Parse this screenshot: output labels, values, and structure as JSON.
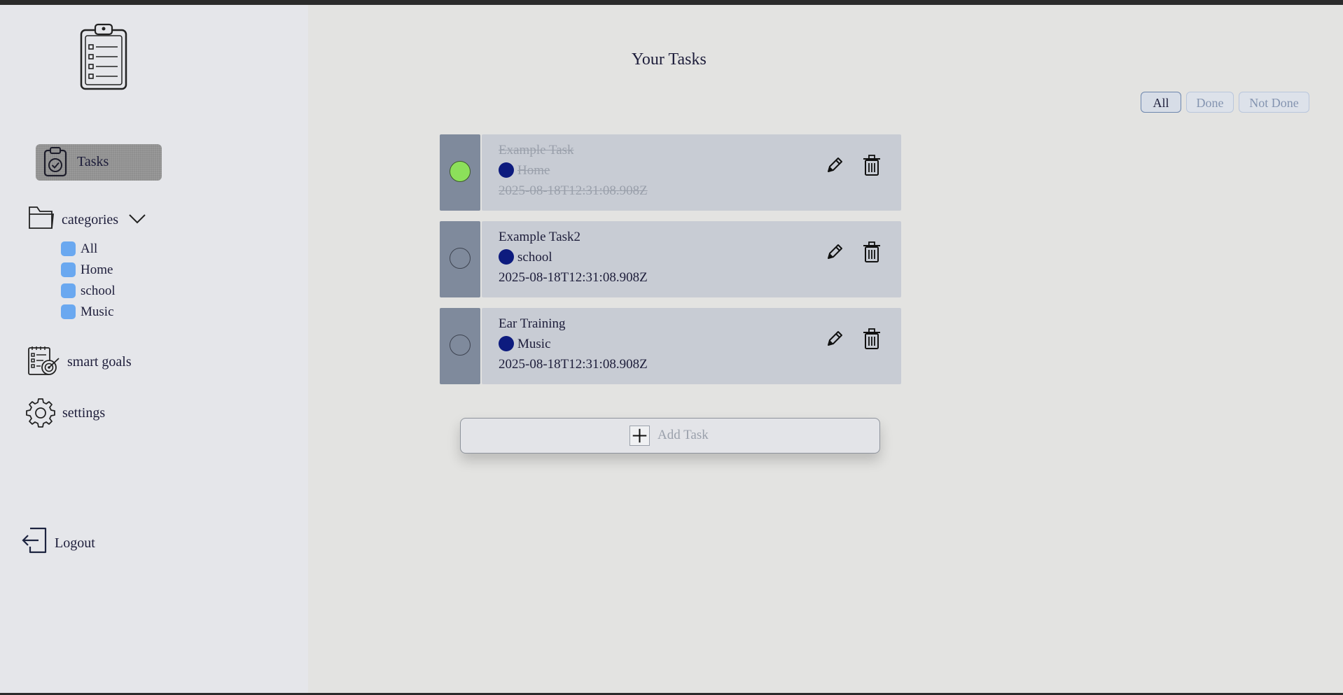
{
  "page": {
    "title": "Your Tasks"
  },
  "sidebar": {
    "nav_tasks": "Tasks",
    "categories_label": "categories",
    "categories": [
      "All",
      "Home",
      "school",
      "Music"
    ],
    "nav_smart_goals": "smart goals",
    "nav_settings": "settings",
    "nav_logout": "Logout"
  },
  "filters": {
    "all": "All",
    "done": "Done",
    "not_done": "Not Done",
    "selected": "All"
  },
  "tasks": [
    {
      "name": "Example Task",
      "category": "Home",
      "date": "2025-08-18T12:31:08.908Z",
      "done": true
    },
    {
      "name": "Example Task2",
      "category": "school",
      "date": "2025-08-18T12:31:08.908Z",
      "done": false
    },
    {
      "name": "Ear Training",
      "category": "Music",
      "date": "2025-08-18T12:31:08.908Z",
      "done": false
    }
  ],
  "add_task": {
    "label": "Add Task"
  },
  "colors": {
    "done_check": "#8ce05a",
    "category_dot": "#0d1b7e",
    "category_chip": "#6aa8f0",
    "strip": "#7f8a9c",
    "card": "#c8ccd4"
  },
  "icons": {
    "logo": "clipboard-list-icon",
    "tasks": "clipboard-check-icon",
    "categories": "folder-icon",
    "chevron": "chevron-down-icon",
    "smart_goals": "checklist-target-icon",
    "settings": "gear-icon",
    "logout": "logout-icon",
    "edit": "pencil-icon",
    "delete": "trash-icon",
    "add": "plus-icon"
  }
}
